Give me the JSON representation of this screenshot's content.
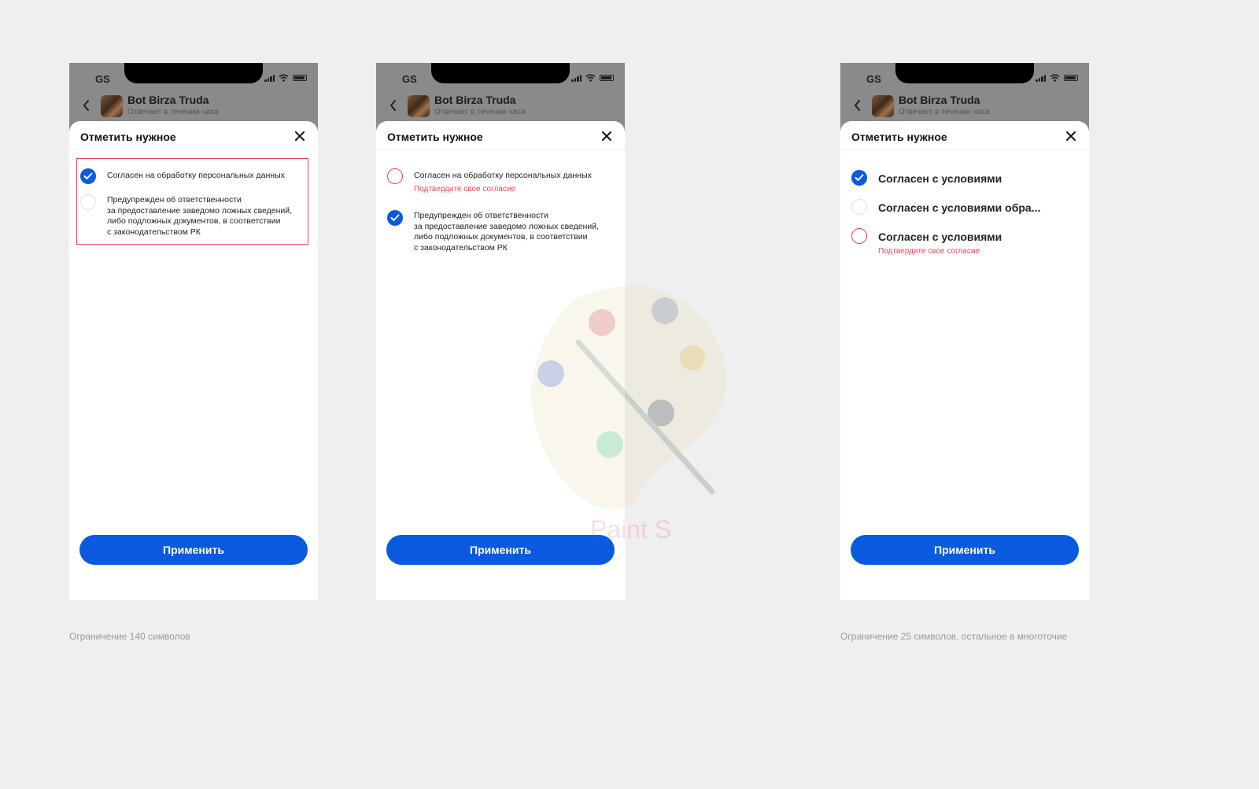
{
  "screens": [
    {
      "carrier": "GS",
      "chat_title": "Bot Birza Truda",
      "chat_subtitle": "Отвечает в течении часа",
      "sheet_title": "Отметить нужное",
      "options": [
        {
          "state": "checked",
          "label": "Согласен на обработку персональных данных"
        },
        {
          "state": "empty",
          "label": "Предупрежден об ответственности\nза предоставление заведомо ложных сведений,\nлибо подложных документов, в соответствии\nс законодательством РК"
        }
      ],
      "apply_label": "Применить"
    },
    {
      "carrier": "GS",
      "chat_title": "Bot Birza Truda",
      "chat_subtitle": "Отвечает в течении часа",
      "sheet_title": "Отметить нужное",
      "options": [
        {
          "state": "error",
          "label": "Согласен на обработку персональных данных",
          "error": "Подтвердите свое согласие"
        },
        {
          "state": "checked",
          "label": "Предупрежден об ответственности\nза предоставление заведомо ложных сведений,\nлибо подложных документов, в соответствии\nс законодательством РК"
        }
      ],
      "apply_label": "Применить"
    },
    {
      "carrier": "GS",
      "chat_title": "Bot Birza Truda",
      "chat_subtitle": "Отвечает в течении часа",
      "sheet_title": "Отметить нужное",
      "options": [
        {
          "state": "checked",
          "label": "Согласен с условиями"
        },
        {
          "state": "empty",
          "label": "Согласен с условиями обра..."
        },
        {
          "state": "error",
          "label": "Согласен с условиями",
          "error": "Подтвердите свое согласие"
        }
      ],
      "apply_label": "Применить"
    }
  ],
  "captions": {
    "left": "Ограничение 140 символов",
    "right": "Ограничение 25 символов, остальное в многоточие"
  },
  "watermark_text": "Paint S",
  "colors": {
    "accent": "#0a5adf",
    "error": "#ef4455",
    "background": "#efefef"
  }
}
